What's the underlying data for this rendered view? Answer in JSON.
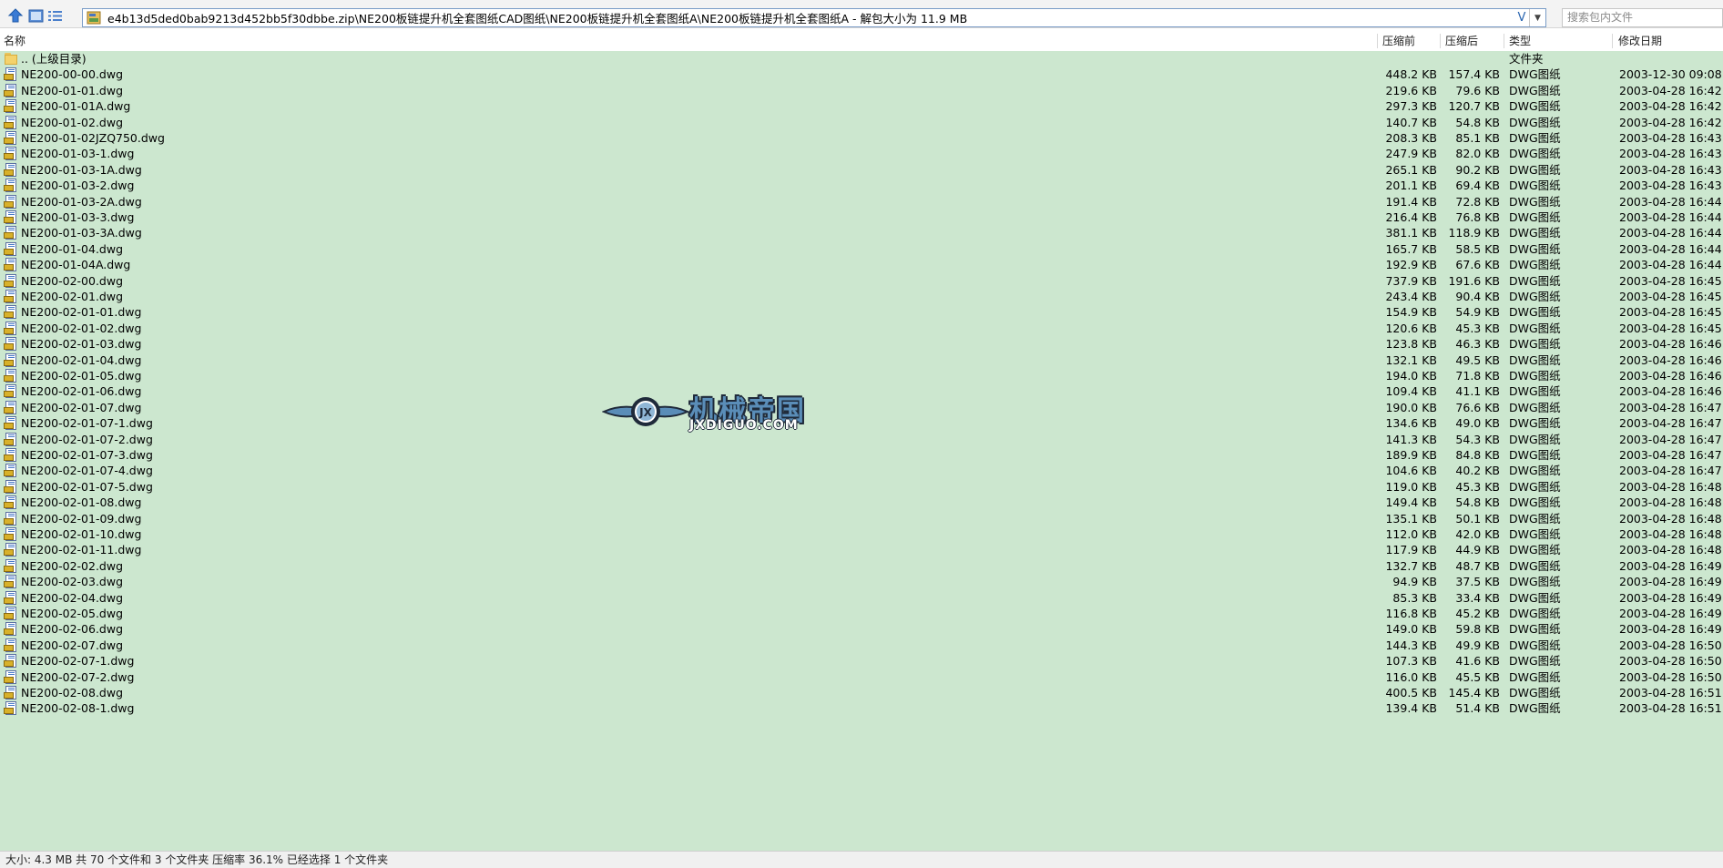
{
  "toolbar": {
    "up_icon": "up-arrow-icon",
    "thumbnail_icon": "thumbnail-view-icon",
    "list_icon": "list-view-icon"
  },
  "address": {
    "path": "e4b13d5ded0bab9213d452bb5f30dbbe.zip\\NE200板链提升机全套图纸CAD图纸\\NE200板链提升机全套图纸A\\NE200板链提升机全套图纸A - 解包大小为 11.9 MB",
    "history_glyph": "V"
  },
  "search": {
    "placeholder": "搜索包内文件"
  },
  "columns": {
    "name": "名称",
    "before": "压缩前",
    "after": "压缩后",
    "type": "类型",
    "date": "修改日期"
  },
  "parent_row": {
    "name": ".. (上级目录)",
    "type": "文件夹"
  },
  "files": [
    {
      "name": "NE200-00-00.dwg",
      "before": "448.2 KB",
      "after": "157.4 KB",
      "type": "DWG图纸",
      "date": "2003-12-30 09:08"
    },
    {
      "name": "NE200-01-01.dwg",
      "before": "219.6 KB",
      "after": "79.6 KB",
      "type": "DWG图纸",
      "date": "2003-04-28 16:42"
    },
    {
      "name": "NE200-01-01A.dwg",
      "before": "297.3 KB",
      "after": "120.7 KB",
      "type": "DWG图纸",
      "date": "2003-04-28 16:42"
    },
    {
      "name": "NE200-01-02.dwg",
      "before": "140.7 KB",
      "after": "54.8 KB",
      "type": "DWG图纸",
      "date": "2003-04-28 16:42"
    },
    {
      "name": "NE200-01-02JZQ750.dwg",
      "before": "208.3 KB",
      "after": "85.1 KB",
      "type": "DWG图纸",
      "date": "2003-04-28 16:43"
    },
    {
      "name": "NE200-01-03-1.dwg",
      "before": "247.9 KB",
      "after": "82.0 KB",
      "type": "DWG图纸",
      "date": "2003-04-28 16:43"
    },
    {
      "name": "NE200-01-03-1A.dwg",
      "before": "265.1 KB",
      "after": "90.2 KB",
      "type": "DWG图纸",
      "date": "2003-04-28 16:43"
    },
    {
      "name": "NE200-01-03-2.dwg",
      "before": "201.1 KB",
      "after": "69.4 KB",
      "type": "DWG图纸",
      "date": "2003-04-28 16:43"
    },
    {
      "name": "NE200-01-03-2A.dwg",
      "before": "191.4 KB",
      "after": "72.8 KB",
      "type": "DWG图纸",
      "date": "2003-04-28 16:44"
    },
    {
      "name": "NE200-01-03-3.dwg",
      "before": "216.4 KB",
      "after": "76.8 KB",
      "type": "DWG图纸",
      "date": "2003-04-28 16:44"
    },
    {
      "name": "NE200-01-03-3A.dwg",
      "before": "381.1 KB",
      "after": "118.9 KB",
      "type": "DWG图纸",
      "date": "2003-04-28 16:44"
    },
    {
      "name": "NE200-01-04.dwg",
      "before": "165.7 KB",
      "after": "58.5 KB",
      "type": "DWG图纸",
      "date": "2003-04-28 16:44"
    },
    {
      "name": "NE200-01-04A.dwg",
      "before": "192.9 KB",
      "after": "67.6 KB",
      "type": "DWG图纸",
      "date": "2003-04-28 16:44"
    },
    {
      "name": "NE200-02-00.dwg",
      "before": "737.9 KB",
      "after": "191.6 KB",
      "type": "DWG图纸",
      "date": "2003-04-28 16:45"
    },
    {
      "name": "NE200-02-01.dwg",
      "before": "243.4 KB",
      "after": "90.4 KB",
      "type": "DWG图纸",
      "date": "2003-04-28 16:45"
    },
    {
      "name": "NE200-02-01-01.dwg",
      "before": "154.9 KB",
      "after": "54.9 KB",
      "type": "DWG图纸",
      "date": "2003-04-28 16:45"
    },
    {
      "name": "NE200-02-01-02.dwg",
      "before": "120.6 KB",
      "after": "45.3 KB",
      "type": "DWG图纸",
      "date": "2003-04-28 16:45"
    },
    {
      "name": "NE200-02-01-03.dwg",
      "before": "123.8 KB",
      "after": "46.3 KB",
      "type": "DWG图纸",
      "date": "2003-04-28 16:46"
    },
    {
      "name": "NE200-02-01-04.dwg",
      "before": "132.1 KB",
      "after": "49.5 KB",
      "type": "DWG图纸",
      "date": "2003-04-28 16:46"
    },
    {
      "name": "NE200-02-01-05.dwg",
      "before": "194.0 KB",
      "after": "71.8 KB",
      "type": "DWG图纸",
      "date": "2003-04-28 16:46"
    },
    {
      "name": "NE200-02-01-06.dwg",
      "before": "109.4 KB",
      "after": "41.1 KB",
      "type": "DWG图纸",
      "date": "2003-04-28 16:46"
    },
    {
      "name": "NE200-02-01-07.dwg",
      "before": "190.0 KB",
      "after": "76.6 KB",
      "type": "DWG图纸",
      "date": "2003-04-28 16:47"
    },
    {
      "name": "NE200-02-01-07-1.dwg",
      "before": "134.6 KB",
      "after": "49.0 KB",
      "type": "DWG图纸",
      "date": "2003-04-28 16:47"
    },
    {
      "name": "NE200-02-01-07-2.dwg",
      "before": "141.3 KB",
      "after": "54.3 KB",
      "type": "DWG图纸",
      "date": "2003-04-28 16:47"
    },
    {
      "name": "NE200-02-01-07-3.dwg",
      "before": "189.9 KB",
      "after": "84.8 KB",
      "type": "DWG图纸",
      "date": "2003-04-28 16:47"
    },
    {
      "name": "NE200-02-01-07-4.dwg",
      "before": "104.6 KB",
      "after": "40.2 KB",
      "type": "DWG图纸",
      "date": "2003-04-28 16:47"
    },
    {
      "name": "NE200-02-01-07-5.dwg",
      "before": "119.0 KB",
      "after": "45.3 KB",
      "type": "DWG图纸",
      "date": "2003-04-28 16:48"
    },
    {
      "name": "NE200-02-01-08.dwg",
      "before": "149.4 KB",
      "after": "54.8 KB",
      "type": "DWG图纸",
      "date": "2003-04-28 16:48"
    },
    {
      "name": "NE200-02-01-09.dwg",
      "before": "135.1 KB",
      "after": "50.1 KB",
      "type": "DWG图纸",
      "date": "2003-04-28 16:48"
    },
    {
      "name": "NE200-02-01-10.dwg",
      "before": "112.0 KB",
      "after": "42.0 KB",
      "type": "DWG图纸",
      "date": "2003-04-28 16:48"
    },
    {
      "name": "NE200-02-01-11.dwg",
      "before": "117.9 KB",
      "after": "44.9 KB",
      "type": "DWG图纸",
      "date": "2003-04-28 16:48"
    },
    {
      "name": "NE200-02-02.dwg",
      "before": "132.7 KB",
      "after": "48.7 KB",
      "type": "DWG图纸",
      "date": "2003-04-28 16:49"
    },
    {
      "name": "NE200-02-03.dwg",
      "before": "94.9 KB",
      "after": "37.5 KB",
      "type": "DWG图纸",
      "date": "2003-04-28 16:49"
    },
    {
      "name": "NE200-02-04.dwg",
      "before": "85.3 KB",
      "after": "33.4 KB",
      "type": "DWG图纸",
      "date": "2003-04-28 16:49"
    },
    {
      "name": "NE200-02-05.dwg",
      "before": "116.8 KB",
      "after": "45.2 KB",
      "type": "DWG图纸",
      "date": "2003-04-28 16:49"
    },
    {
      "name": "NE200-02-06.dwg",
      "before": "149.0 KB",
      "after": "59.8 KB",
      "type": "DWG图纸",
      "date": "2003-04-28 16:49"
    },
    {
      "name": "NE200-02-07.dwg",
      "before": "144.3 KB",
      "after": "49.9 KB",
      "type": "DWG图纸",
      "date": "2003-04-28 16:50"
    },
    {
      "name": "NE200-02-07-1.dwg",
      "before": "107.3 KB",
      "after": "41.6 KB",
      "type": "DWG图纸",
      "date": "2003-04-28 16:50"
    },
    {
      "name": "NE200-02-07-2.dwg",
      "before": "116.0 KB",
      "after": "45.5 KB",
      "type": "DWG图纸",
      "date": "2003-04-28 16:50"
    },
    {
      "name": "NE200-02-08.dwg",
      "before": "400.5 KB",
      "after": "145.4 KB",
      "type": "DWG图纸",
      "date": "2003-04-28 16:51"
    },
    {
      "name": "NE200-02-08-1.dwg",
      "before": "139.4 KB",
      "after": "51.4 KB",
      "type": "DWG图纸",
      "date": "2003-04-28 16:51"
    }
  ],
  "watermark": {
    "cn": "机械帝国",
    "en": "JXDIGUO.COM"
  },
  "status": {
    "text": "大小: 4.3 MB 共 70 个文件和 3 个文件夹 压缩率 36.1% 已经选择 1 个文件夹"
  },
  "colors": {
    "list_bg": "#cce7cf",
    "accent": "#2a65b0"
  }
}
